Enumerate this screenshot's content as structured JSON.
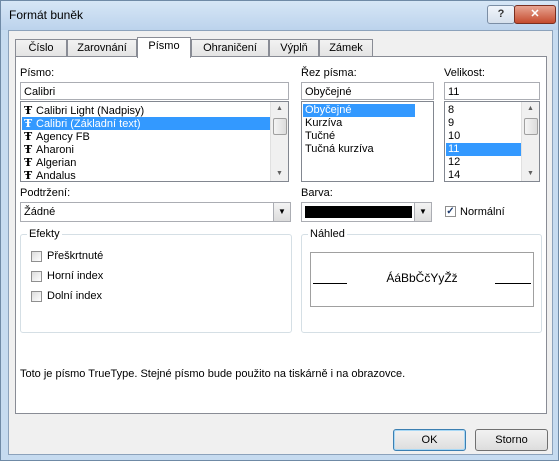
{
  "window": {
    "title": "Formát buněk",
    "help_label": "?",
    "close_label": "✕"
  },
  "tabs": [
    {
      "label": "Číslo"
    },
    {
      "label": "Zarovnání"
    },
    {
      "label": "Písmo",
      "active": true
    },
    {
      "label": "Ohraničení"
    },
    {
      "label": "Výplň"
    },
    {
      "label": "Zámek"
    }
  ],
  "font": {
    "label": "Písmo:",
    "value": "Calibri",
    "items": [
      "Calibri Light (Nadpisy)",
      "Calibri (Základní text)",
      "Agency FB",
      "Aharoni",
      "Algerian",
      "Andalus"
    ],
    "selected_index": 1,
    "item_icon": "truetype-icon"
  },
  "style": {
    "label": "Řez písma:",
    "value": "Obyčejné",
    "items": [
      "Obyčejné",
      "Kurzíva",
      "Tučné",
      "Tučná kurzíva"
    ],
    "selected_index": 0
  },
  "size": {
    "label": "Velikost:",
    "value": "11",
    "items": [
      "8",
      "9",
      "10",
      "11",
      "12",
      "14"
    ],
    "selected_index": 3
  },
  "underline": {
    "label": "Podtržení:",
    "value": "Žádné"
  },
  "color": {
    "label": "Barva:",
    "swatch": "#000000",
    "normal_label": "Normální",
    "normal_checked": true
  },
  "effects": {
    "label": "Efekty",
    "items": [
      {
        "label": "Přeškrtnuté",
        "checked": false
      },
      {
        "label": "Horní index",
        "checked": false
      },
      {
        "label": "Dolní index",
        "checked": false
      }
    ]
  },
  "preview": {
    "label": "Náhled",
    "sample": "ÁáBbČčYyŽž"
  },
  "info_text": "Toto je písmo TrueType. Stejné písmo bude použito na tiskárně i na obrazovce.",
  "buttons": {
    "ok": "OK",
    "cancel": "Storno"
  },
  "colors": {
    "selection": "#3399ff",
    "title_bg": "#c6dbf0",
    "close_bg": "#c44b2e"
  }
}
